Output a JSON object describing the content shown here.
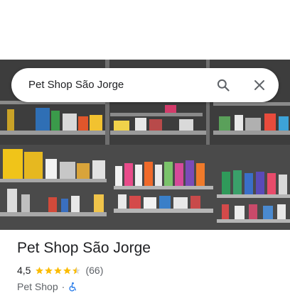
{
  "search": {
    "query": "Pet Shop São Jorge"
  },
  "icons": {
    "search": "search-icon",
    "close": "close-icon",
    "star": "star-icon",
    "accessibility": "wheelchair-icon"
  },
  "place": {
    "name": "Pet Shop São Jorge",
    "rating_text": "4,5",
    "rating_value": 4.5,
    "review_count": "(66)",
    "category": "Pet Shop",
    "separator": "·"
  },
  "colors": {
    "star": "#fbbc04",
    "accessibility": "#1a73e8",
    "text": "#202124",
    "secondary": "#5f6368"
  }
}
